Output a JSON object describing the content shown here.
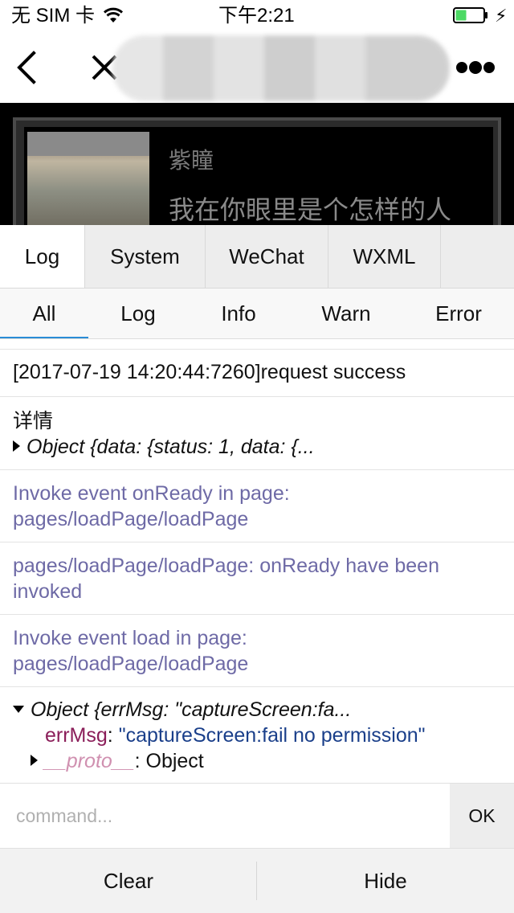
{
  "status_bar": {
    "carrier": "无 SIM 卡",
    "time": "下午2:21"
  },
  "nav": {
    "back_icon": "chevron-left-icon",
    "close_icon": "close-icon",
    "more_icon": "more-dots-icon"
  },
  "background_page": {
    "card_title": "紫瞳",
    "card_subtitle": "我在你眼里是个怎样的人"
  },
  "console": {
    "tabs": [
      {
        "label": "Log",
        "active": true
      },
      {
        "label": "System",
        "active": false
      },
      {
        "label": "WeChat",
        "active": false
      },
      {
        "label": "WXML",
        "active": false
      }
    ],
    "filters": [
      {
        "label": "All",
        "active": true
      },
      {
        "label": "Log",
        "active": false
      },
      {
        "label": "Info",
        "active": false
      },
      {
        "label": "Warn",
        "active": false
      },
      {
        "label": "Error",
        "active": false
      }
    ],
    "logs": {
      "request": "[2017-07-19 14:20:44:7260]request success",
      "detail_label": "详情",
      "detail_object": "Object {data: {status: 1, data: {...",
      "info1_line1": "Invoke event onReady in page:",
      "info1_line2": "pages/loadPage/loadPage",
      "info2_line1": "pages/loadPage/loadPage: onReady have been",
      "info2_line2": "invoked",
      "info3_line1": "Invoke event load in page:",
      "info3_line2": "pages/loadPage/loadPage",
      "err_object": "Object {errMsg: \"captureScreen:fa...",
      "err_key": "errMsg",
      "err_sep": ": ",
      "err_value": "\"captureScreen:fail no permission\"",
      "proto_key": "__proto__",
      "proto_value": ": Object"
    },
    "command": {
      "placeholder": "command...",
      "value": "",
      "ok_label": "OK"
    },
    "toolbar": {
      "clear_label": "Clear",
      "hide_label": "Hide"
    }
  },
  "colors": {
    "info_text": "#6e6aa6",
    "active_filter_underline": "#2a8cd6",
    "object_key": "#8b1f5a",
    "string_value": "#1a3f8a",
    "battery_fill": "#4cd964"
  }
}
